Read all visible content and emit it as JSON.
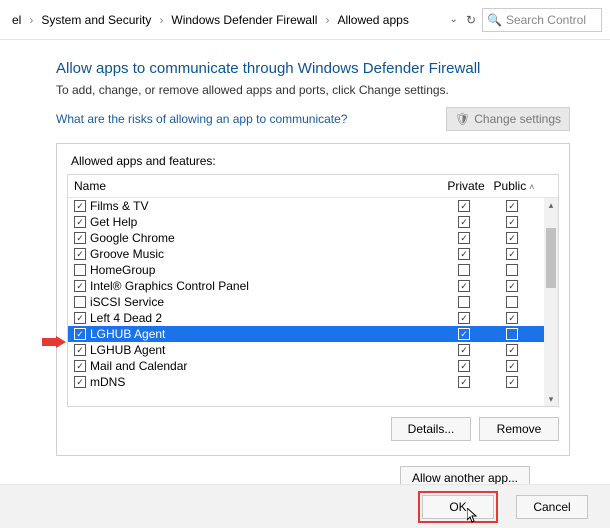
{
  "breadcrumbs": {
    "c0": "el",
    "c1": "System and Security",
    "c2": "Windows Defender Firewall",
    "c3": "Allowed apps"
  },
  "search": {
    "placeholder": "Search Control"
  },
  "heading": "Allow apps to communicate through Windows Defender Firewall",
  "subtext": "To add, change, or remove allowed apps and ports, click Change settings.",
  "help_link": "What are the risks of allowing an app to communicate?",
  "change_settings": "Change settings",
  "panel_label": "Allowed apps and features:",
  "columns": {
    "name": "Name",
    "private": "Private",
    "public": "Public"
  },
  "rows": [
    {
      "name": "Films & TV",
      "enabled": true,
      "private": true,
      "public": true,
      "selected": false
    },
    {
      "name": "Get Help",
      "enabled": true,
      "private": true,
      "public": true,
      "selected": false
    },
    {
      "name": "Google Chrome",
      "enabled": true,
      "private": true,
      "public": true,
      "selected": false
    },
    {
      "name": "Groove Music",
      "enabled": true,
      "private": true,
      "public": true,
      "selected": false
    },
    {
      "name": "HomeGroup",
      "enabled": false,
      "private": false,
      "public": false,
      "selected": false
    },
    {
      "name": "Intel® Graphics Control Panel",
      "enabled": true,
      "private": true,
      "public": true,
      "selected": false
    },
    {
      "name": "iSCSI Service",
      "enabled": false,
      "private": false,
      "public": false,
      "selected": false
    },
    {
      "name": "Left 4 Dead 2",
      "enabled": true,
      "private": true,
      "public": true,
      "selected": false
    },
    {
      "name": "LGHUB Agent",
      "enabled": true,
      "private": true,
      "public": false,
      "selected": true
    },
    {
      "name": "LGHUB Agent",
      "enabled": true,
      "private": true,
      "public": true,
      "selected": false
    },
    {
      "name": "Mail and Calendar",
      "enabled": true,
      "private": true,
      "public": true,
      "selected": false
    },
    {
      "name": "mDNS",
      "enabled": true,
      "private": true,
      "public": true,
      "selected": false
    }
  ],
  "buttons": {
    "details": "Details...",
    "remove": "Remove",
    "allow_another": "Allow another app...",
    "ok": "OK",
    "cancel": "Cancel"
  }
}
